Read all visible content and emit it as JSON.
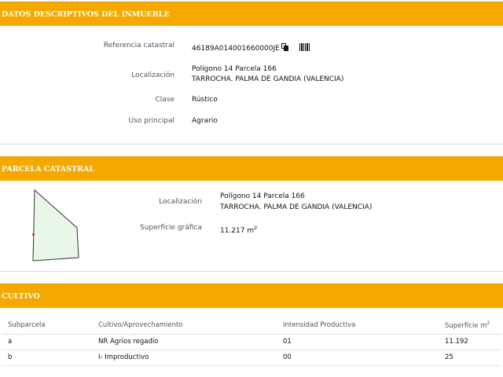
{
  "datos": {
    "title": "DATOS DESCRIPTIVOS DEL INMUEBLE",
    "ref_label": "Referencia catastral",
    "ref_value": "46189A014001660000JE",
    "loc_label": "Localización",
    "loc_line1": "Polígono 14 Parcela 166",
    "loc_line2": "TARROCHA. PALMA DE GANDIA (VALENCIA)",
    "clase_label": "Clase",
    "clase_value": "Rústico",
    "uso_label": "Uso principal",
    "uso_value": "Agrario"
  },
  "parcela": {
    "title": "PARCELA CATASTRAL",
    "loc_label": "Localización",
    "loc_line1": "Polígono 14 Parcela 166",
    "loc_line2": "TARROCHA. PALMA DE GANDIA (VALENCIA)",
    "sup_label": "Superficie gráfica",
    "sup_value": "11.217 m",
    "sup_sup": "2"
  },
  "cultivo": {
    "title": "CULTIVO",
    "headers": [
      "Subparcela",
      "Cultivo/Aprovechamiento",
      "Intensidad Productiva",
      "Superficie m"
    ],
    "header_sup": "2",
    "rows": [
      [
        "a",
        "NR Agrios regadío",
        "01",
        "11.192"
      ],
      [
        "b",
        "I- Improductivo",
        "00",
        "25"
      ]
    ]
  },
  "colors": {
    "accent": "#f5a900",
    "parcel_fill": "#e8f7e8"
  },
  "icons": [
    "copy-icon",
    "barcode-icon"
  ]
}
